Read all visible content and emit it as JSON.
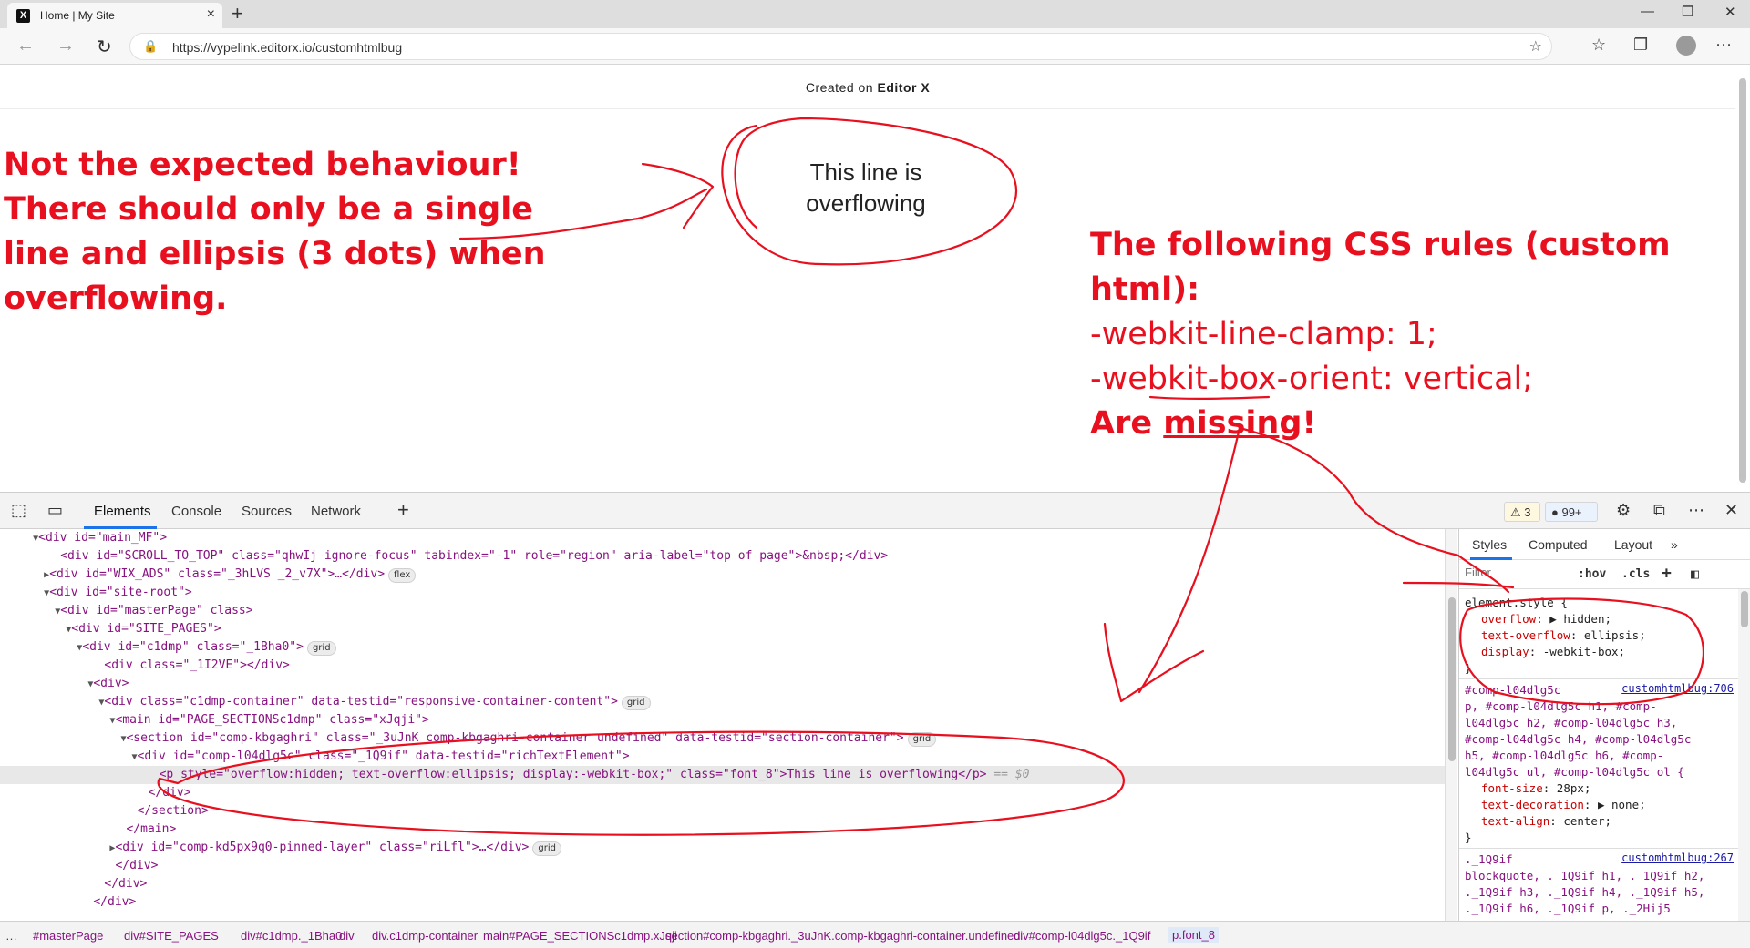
{
  "browser": {
    "tab_title": "Home | My Site",
    "favicon_letter": "X",
    "new_tab": "+",
    "close_tab": "×",
    "url": "https://vypelink.editorx.io/customhtmlbug",
    "window_controls": {
      "minimize": "—",
      "restore": "❐",
      "close": "✕"
    }
  },
  "page": {
    "created_prefix": "Created on ",
    "created_brand": "Editor X",
    "overflow_text": "This line is overflowing"
  },
  "annotations": {
    "left_lines": [
      "Not the expected behaviour!",
      "There should only be a single",
      "line and ellipsis (3 dots) when",
      "overflowing."
    ],
    "right_heading": "The following CSS rules (custom html):",
    "right_rule_1": "-webkit-line-clamp: 1;",
    "right_rule_2": "-webkit-box-orient: vertical;",
    "right_are": "Are ",
    "right_missing": "missing",
    "right_bang": "!",
    "color": "#e8101e"
  },
  "devtools": {
    "tabs": [
      "Elements",
      "Console",
      "Sources",
      "Network"
    ],
    "add_tab": "+",
    "warnings": "3",
    "messages": "99+",
    "dom_lines": [
      {
        "indent": 3,
        "arrow": "▼",
        "html": "<div id=\"main_MF\">"
      },
      {
        "indent": 5,
        "arrow": "",
        "html": "<div id=\"SCROLL_TO_TOP\" class=\"qhwIj ignore-focus\" tabindex=\"-1\" role=\"region\" aria-label=\"top of page\">&nbsp;</div>"
      },
      {
        "indent": 4,
        "arrow": "▶",
        "html": "<div id=\"WIX_ADS\" class=\"_3hLVS _2_v7X\">…</div>",
        "pill": "flex"
      },
      {
        "indent": 4,
        "arrow": "▼",
        "html": "<div id=\"site-root\">"
      },
      {
        "indent": 5,
        "arrow": "▼",
        "html": "<div id=\"masterPage\" class>"
      },
      {
        "indent": 6,
        "arrow": "▼",
        "html": "<div id=\"SITE_PAGES\">"
      },
      {
        "indent": 7,
        "arrow": "▼",
        "html": "<div id=\"c1dmp\" class=\"_1Bha0\">",
        "pill": "grid"
      },
      {
        "indent": 9,
        "arrow": "",
        "html": "<div class=\"_1I2VE\"></div>"
      },
      {
        "indent": 8,
        "arrow": "▼",
        "html": "<div>"
      },
      {
        "indent": 9,
        "arrow": "▼",
        "html": "<div class=\"c1dmp-container\" data-testid=\"responsive-container-content\">",
        "pill": "grid"
      },
      {
        "indent": 10,
        "arrow": "▼",
        "html": "<main id=\"PAGE_SECTIONSc1dmp\" class=\"xJqji\">"
      },
      {
        "indent": 11,
        "arrow": "▼",
        "html": "<section id=\"comp-kbgaghri\" class=\"_3uJnK comp-kbgaghri-container undefined\" data-testid=\"section-container\">",
        "pill": "grid"
      },
      {
        "indent": 12,
        "arrow": "▼",
        "html": "<div id=\"comp-l04dlg5c\" class=\"_1Q9if\" data-testid=\"richTextElement\">"
      },
      {
        "indent": 14,
        "arrow": "",
        "html": "<p style=\"overflow:hidden; text-overflow:ellipsis; display:-webkit-box;\" class=\"font_8\">This line is overflowing</p>",
        "suffix": " == $0",
        "selected": true
      },
      {
        "indent": 13,
        "arrow": "",
        "html": "</div>"
      },
      {
        "indent": 12,
        "arrow": "",
        "html": "</section>"
      },
      {
        "indent": 11,
        "arrow": "",
        "html": "</main>"
      },
      {
        "indent": 10,
        "arrow": "▶",
        "html": "<div id=\"comp-kd5px9q0-pinned-layer\" class=\"riLfl\">…</div>",
        "pill": "grid"
      },
      {
        "indent": 10,
        "arrow": "",
        "html": "</div>"
      },
      {
        "indent": 9,
        "arrow": "",
        "html": "</div>"
      },
      {
        "indent": 8,
        "arrow": "",
        "html": "</div>"
      }
    ],
    "styles": {
      "tabs": [
        "Styles",
        "Computed",
        "Layout"
      ],
      "more": "»",
      "filter_placeholder": "Filter",
      "hov": ":hov",
      "cls": ".cls",
      "element_style_selector": "element.style {",
      "element_style_rules": [
        {
          "prop": "overflow",
          "val": "▶ hidden;"
        },
        {
          "prop": "text-overflow",
          "val": "ellipsis;"
        },
        {
          "prop": "display",
          "val": "-webkit-box;"
        }
      ],
      "close_brace": "}",
      "rule2_source": "customhtmlbug:706",
      "rule2_selector_lines": [
        "#comp-l04dlg5c",
        "p, #comp-l04dlg5c h1, #comp-",
        "l04dlg5c h2, #comp-l04dlg5c h3,",
        "#comp-l04dlg5c h4, #comp-l04dlg5c",
        "h5, #comp-l04dlg5c h6, #comp-",
        "l04dlg5c ul, #comp-l04dlg5c ol {"
      ],
      "rule2_rules": [
        {
          "prop": "font-size",
          "val": "28px;"
        },
        {
          "prop": "text-decoration",
          "val": "▶ none;"
        },
        {
          "prop": "text-align",
          "val": "center;"
        }
      ],
      "rule3_source": "customhtmlbug:267",
      "rule3_selector_lines": [
        "._1Q9if",
        "blockquote, ._1Q9if h1, ._1Q9if h2,",
        "._1Q9if h3, ._1Q9if h4, ._1Q9if h5,",
        "._1Q9if h6, ._1Q9if p, ._2Hij5"
      ]
    },
    "breadcrumbs": [
      "…",
      "#masterPage",
      "div#SITE_PAGES",
      "div#c1dmp._1Bha0",
      "div",
      "div.c1dmp-container",
      "main#PAGE_SECTIONSc1dmp.xJqji",
      "section#comp-kbgaghri._3uJnK.comp-kbgaghri-container.undefined",
      "div#comp-l04dlg5c._1Q9if",
      "p.font_8"
    ]
  }
}
